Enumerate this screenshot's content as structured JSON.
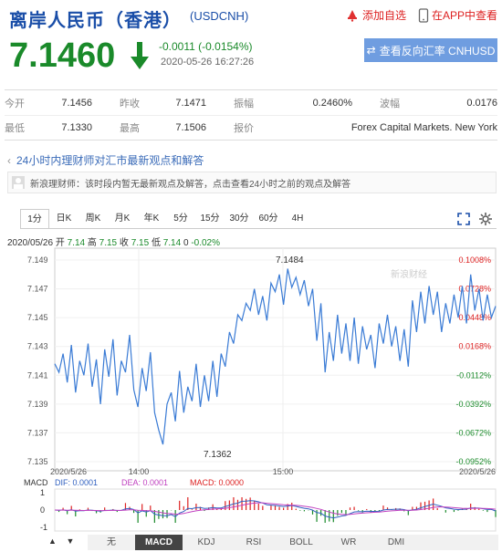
{
  "header": {
    "title": "离岸人民币（香港）",
    "code": "(USDCNH)",
    "add_watch": "添加自选",
    "app_watch": "在APP中查看"
  },
  "quote": {
    "price": "7.1460",
    "change": "-0.0011 (-0.0154%)",
    "time": "2020-05-26 16:27:26",
    "reverse_button": "查看反向汇率 CNHUSD"
  },
  "stats": {
    "row1": [
      {
        "k": "今开",
        "v": "7.1456"
      },
      {
        "k": "昨收",
        "v": "7.1471"
      },
      {
        "k": "振幅",
        "v": "0.2460%"
      },
      {
        "k": "波幅",
        "v": "0.0176"
      }
    ],
    "row2": [
      {
        "k": "最低",
        "v": "7.1330"
      },
      {
        "k": "最高",
        "v": "7.1506"
      },
      {
        "k": "报价",
        "v": "Forex Capital Markets. New York"
      }
    ]
  },
  "advisor": {
    "headline": "24小时内理财师对汇市最新观点和解答",
    "notice": "新浪理财师：该时段内暂无最新观点及解答，点击查看24小时之前的观点及解答"
  },
  "tabs": [
    "1分",
    "日K",
    "周K",
    "月K",
    "年K",
    "5分",
    "15分",
    "30分",
    "60分",
    "4H"
  ],
  "ticker": {
    "date": "2020/05/26",
    "open_label": "开",
    "open": "7.14",
    "high_label": "高",
    "high": "7.15",
    "close_label": "收",
    "close": "7.15",
    "low_label": "低",
    "low": "7.14",
    "vol": "0",
    "pct": "-0.02%"
  },
  "chart_data": {
    "type": "line",
    "y_ticks": [
      "7.149",
      "7.147",
      "7.145",
      "7.143",
      "7.141",
      "7.139",
      "7.137",
      "7.135"
    ],
    "pct_ticks": [
      "0.1008%",
      "0.0728%",
      "0.0448%",
      "0.0168%",
      "-0.0112%",
      "-0.0392%",
      "-0.0672%",
      "-0.0952%"
    ],
    "x_ticks": [
      "2020/5/26",
      "14:00",
      "15:00",
      "2020/5/26"
    ],
    "ylim": [
      7.135,
      7.149
    ],
    "max_label": "7.1484",
    "min_label": "7.1362",
    "watermark": "新浪财经",
    "values": [
      7.1418,
      7.1412,
      7.1425,
      7.1405,
      7.1431,
      7.1398,
      7.142,
      7.141,
      7.1432,
      7.1402,
      7.1421,
      7.139,
      7.1428,
      7.1409,
      7.1435,
      7.1396,
      7.142,
      7.1412,
      7.1438,
      7.14,
      7.1388,
      7.1415,
      7.1399,
      7.1426,
      7.1384,
      7.1372,
      7.1362,
      7.139,
      7.1398,
      7.1378,
      7.1413,
      7.1384,
      7.1402,
      7.1392,
      7.1418,
      7.1388,
      7.141,
      7.1392,
      7.142,
      7.1395,
      7.1425,
      7.1416,
      7.144,
      7.1432,
      7.1452,
      7.1448,
      7.146,
      7.1455,
      7.147,
      7.1452,
      7.1465,
      7.1448,
      7.1474,
      7.1468,
      7.148,
      7.1459,
      7.1484,
      7.1471,
      7.1478,
      7.1466,
      7.1476,
      7.1458,
      7.147,
      7.1434,
      7.146,
      7.1412,
      7.144,
      7.142,
      7.1452,
      7.1425,
      7.1446,
      7.142,
      7.145,
      7.1418,
      7.1444,
      7.1428,
      7.1438,
      7.1415,
      7.1446,
      7.1432,
      7.1452,
      7.143,
      7.1444,
      7.142,
      7.1442,
      7.1416,
      7.1462,
      7.144,
      7.1468,
      7.1446,
      7.1472,
      7.1452,
      7.1468,
      7.144,
      7.146,
      7.1446,
      7.1466,
      7.145,
      7.1472,
      7.1446,
      7.148,
      7.1455,
      7.147,
      7.1448,
      7.1466,
      7.145,
      7.1458
    ],
    "macd_label": "MACD",
    "dif_label": "DIF: 0.0001",
    "dea_label": "DEA: 0.0001",
    "macd_val_label": "MACD: 0.0000",
    "macd_ticks": [
      "1",
      "0",
      "-1"
    ],
    "colors": {
      "line": "#3a7bd5",
      "up": "#d22",
      "down": "#1a8a2a",
      "dif": "#3060c0",
      "dea": "#c040c0"
    }
  },
  "indicator_tabs": [
    "无",
    "MACD",
    "KDJ",
    "RSI",
    "BOLL",
    "WR",
    "DMI"
  ],
  "indicator_active": "MACD"
}
